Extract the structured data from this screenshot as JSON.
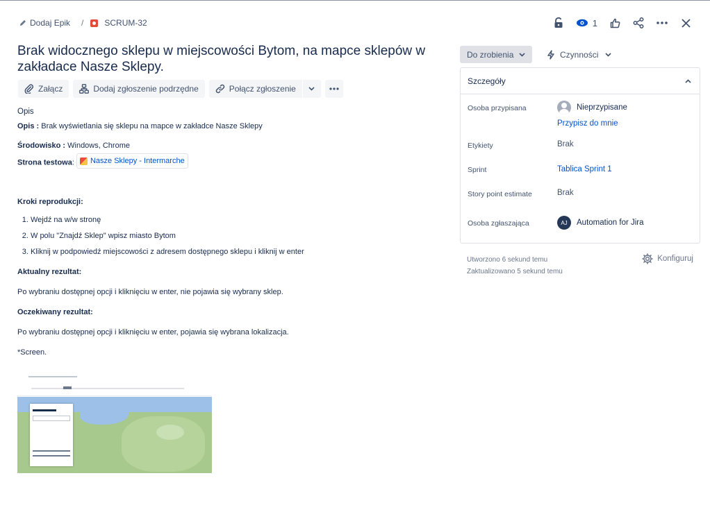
{
  "breadcrumb": {
    "epic_label": "Dodaj Epik",
    "separator": "/",
    "issue_key": "SCRUM-32"
  },
  "top_actions": {
    "watch_count": "1",
    "icons": [
      "unlock-icon",
      "eye-icon",
      "thumbs-up-icon",
      "share-icon",
      "more-icon",
      "close-icon"
    ]
  },
  "issue": {
    "title": "Brak widocznego sklepu w miejscowości Bytom, na mapce sklepów w zakładace Nasze Sklepy."
  },
  "toolbar": {
    "attach": "Załącz",
    "add_child": "Dodaj zgłoszenie podrzędne",
    "link_issue": "Połącz zgłoszenie"
  },
  "description": {
    "heading": "Opis",
    "opis_label": "Opis :",
    "opis_text": " Brak wyświetlania się sklepu na mapce w zakładce Nasze Sklepy",
    "env_label": "Środowisko :",
    "env_text": " Windows, Chrome",
    "test_label": "Strona testowa",
    "test_colon": ":",
    "test_link": "Nasze Sklepy - Intermarche",
    "steps_heading": "Kroki reprodukcji:",
    "steps": [
      "Wejdź na w/w stronę",
      "W polu \"Znajdź Sklep\" wpisz miasto Bytom",
      "Kliknij w podpowiedź miejscowości z adresem dostępnego sklepu i kliknij w enter"
    ],
    "actual_heading": "Aktualny rezultat:",
    "actual_text": "Po wybraniu dostępnej opcji i kliknięciu w enter, nie pojawia się wybrany sklep.",
    "expected_heading": "Oczekiwany rezultat:",
    "expected_text": "Po wybraniu dostępnej opcji i kliknięciu w enter, pojawia się wybrana lokalizacja.",
    "screen_note": "*Screen."
  },
  "status": {
    "label": "Do zrobienia",
    "activity": "Czynności"
  },
  "details": {
    "title": "Szczegóły",
    "assignee_label": "Osoba przypisana",
    "assignee_value": "Nieprzypisane",
    "assign_to_me": "Przypisz do mnie",
    "labels_label": "Etykiety",
    "labels_value": "Brak",
    "sprint_label": "Sprint",
    "sprint_value": "Tablica Sprint 1",
    "story_points_label": "Story point estimate",
    "story_points_value": "Brak",
    "reporter_label": "Osoba zgłaszająca",
    "reporter_initials": "AJ",
    "reporter_value": "Automation for Jira"
  },
  "meta": {
    "created": "Utworzono 6 sekund temu",
    "updated": "Zaktualizowano 5 sekund temu",
    "configure": "Konfiguruj"
  },
  "colors": {
    "text": "#172b4d",
    "link": "#0052cc",
    "bug": "#e5493a",
    "muted": "#6b778c"
  }
}
